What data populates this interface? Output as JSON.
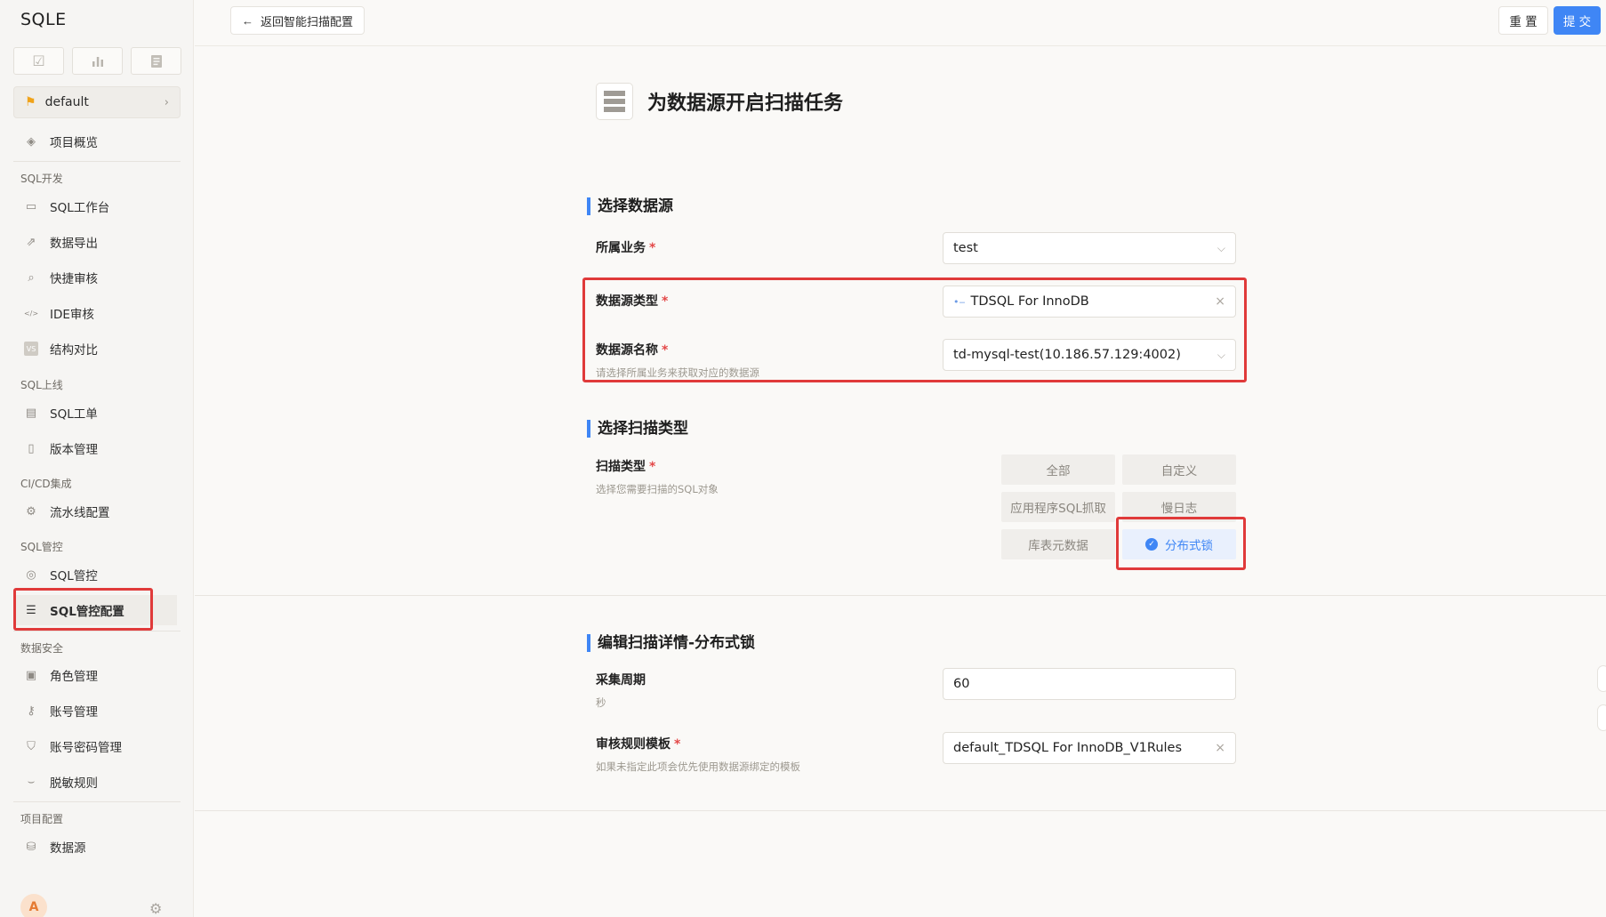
{
  "app": {
    "logo": "SQLE"
  },
  "sidebar": {
    "project": "default",
    "overview": "项目概览",
    "groups": {
      "sql_dev": "SQL开发",
      "sql_release": "SQL上线",
      "cicd": "CI/CD集成",
      "sql_control": "SQL管控",
      "data_security": "数据安全",
      "project_config": "项目配置"
    },
    "items": {
      "workbench": "SQL工作台",
      "data_export": "数据导出",
      "quick_audit": "快捷审核",
      "ide_audit": "IDE审核",
      "schema_compare": "结构对比",
      "sql_order": "SQL工单",
      "version_mgmt": "版本管理",
      "pipeline": "流水线配置",
      "sql_control": "SQL管控",
      "sql_control_config": "SQL管控配置",
      "role_mgmt": "角色管理",
      "account_mgmt": "账号管理",
      "password_mgmt": "账号密码管理",
      "masking_rules": "脱敏规则",
      "data_source": "数据源"
    },
    "avatar": "A",
    "ide_badge": "</>",
    "vs_badge": "VS"
  },
  "toolbar": {
    "back_label": "返回智能扫描配置",
    "reset_label": "重 置",
    "submit_label": "提 交"
  },
  "page": {
    "title": "为数据源开启扫描任务",
    "section1": {
      "title": "选择数据源",
      "business_label": "所属业务",
      "business_value": "test",
      "db_type_label": "数据源类型",
      "db_type_value": "TDSQL For InnoDB",
      "db_name_label": "数据源名称",
      "db_name_hint": "请选择所属业务来获取对应的数据源",
      "db_name_value": "td-mysql-test(10.186.57.129:4002)"
    },
    "section2": {
      "title": "选择扫描类型",
      "scan_type_label": "扫描类型",
      "scan_type_hint": "选择您需要扫描的SQL对象",
      "options": [
        "全部",
        "自定义",
        "应用程序SQL抓取",
        "慢日志",
        "库表元数据",
        "分布式锁"
      ],
      "selected": "分布式锁"
    },
    "section3": {
      "title": "编辑扫描详情-分布式锁",
      "period_label": "采集周期",
      "period_hint": "秒",
      "period_value": "60",
      "template_label": "审核规则模板",
      "template_hint": "如果未指定此项会优先使用数据源绑定的模板",
      "template_value": "default_TDSQL For InnoDB_V1Rules"
    }
  },
  "colors": {
    "accent": "#3f86f5",
    "highlight": "#e03a3a",
    "required": "#e34848"
  }
}
